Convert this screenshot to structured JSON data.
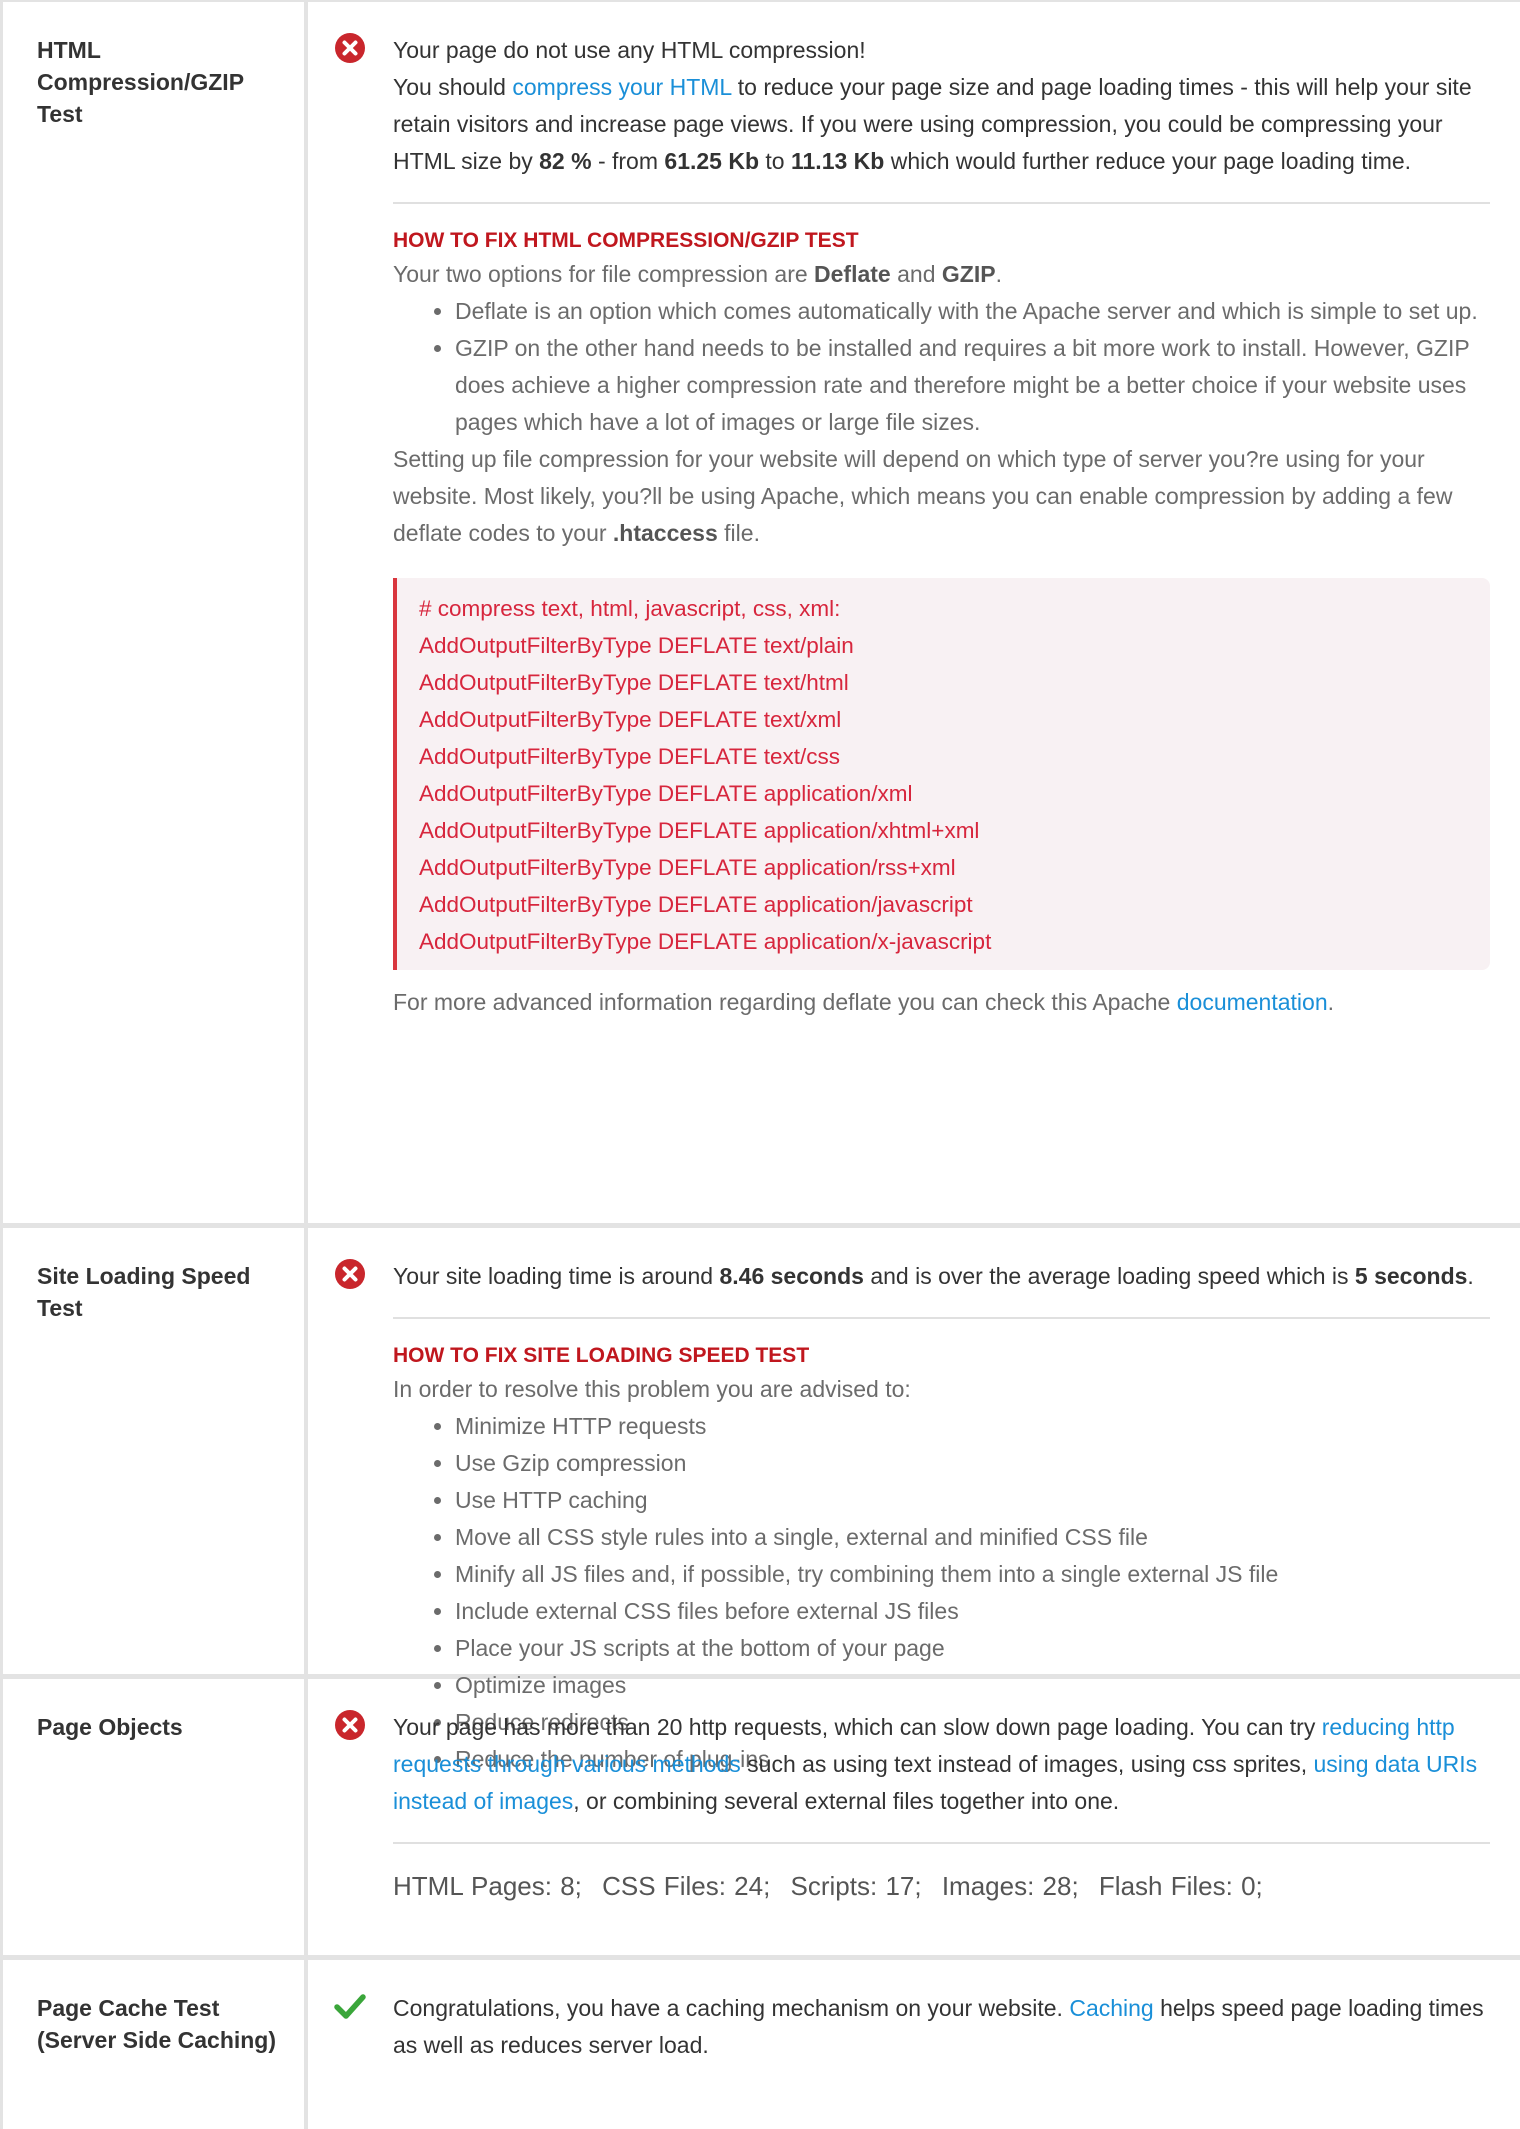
{
  "rows": [
    {
      "name": "HTML Compression/GZIP Test",
      "status": "fail",
      "intro_line1": "Your page do not use any HTML compression!",
      "intro_p_before": "You should ",
      "intro_link": "compress your HTML",
      "intro_p_after1": " to reduce your page size and page loading times - this will help your site retain visitors and increase page views. If you were using compression, you could be compressing your HTML size by ",
      "pct": "82 %",
      "mid1": " - from ",
      "from": "61.25 Kb",
      "mid2": " to ",
      "to": "11.13 Kb",
      "end": " which would further reduce your page loading time.",
      "fix_head": "HOW TO FIX HTML COMPRESSION/GZIP TEST",
      "fix_p1_a": "Your two options for file compression are ",
      "fix_p1_b1": "Deflate",
      "fix_p1_c": " and ",
      "fix_p1_b2": "GZIP",
      "fix_p1_d": ".",
      "fix_list": [
        "Deflate is an option which comes automatically with the Apache server and which is simple to set up.",
        "GZIP on the other hand needs to be installed and requires a bit more work to install. However, GZIP does achieve a higher compression rate and therefore might be a better choice if your website uses pages which have a lot of images or large file sizes."
      ],
      "fix_p2_a": "Setting up file compression for your website will depend on which type of server you?re using for your website. Most likely, you?ll be using Apache, which means you can enable compression by adding a few deflate codes to your ",
      "fix_p2_b": ".htaccess",
      "fix_p2_c": " file.",
      "code_lines": [
        "# compress text, html, javascript, css, xml:",
        "AddOutputFilterByType DEFLATE text/plain",
        "AddOutputFilterByType DEFLATE text/html",
        "AddOutputFilterByType DEFLATE text/xml",
        "AddOutputFilterByType DEFLATE text/css",
        "AddOutputFilterByType DEFLATE application/xml",
        "AddOutputFilterByType DEFLATE application/xhtml+xml",
        "AddOutputFilterByType DEFLATE application/rss+xml",
        "AddOutputFilterByType DEFLATE application/javascript",
        "AddOutputFilterByType DEFLATE application/x-javascript"
      ],
      "adv_a": "For more advanced information regarding deflate you can check this Apache ",
      "adv_link": "documentation",
      "adv_b": "."
    },
    {
      "name": "Site Loading Speed Test",
      "status": "fail",
      "intro_a": "Your site loading time is around ",
      "intro_b1": "8.46 seconds",
      "intro_c": " and is over the average loading speed which is ",
      "intro_b2": "5 seconds",
      "intro_d": ".",
      "fix_head": "HOW TO FIX SITE LOADING SPEED TEST",
      "fix_p1": "In order to resolve this problem you are advised to:",
      "fix_list": [
        "Minimize HTTP requests",
        "Use Gzip compression",
        "Use HTTP caching",
        "Move all CSS style rules into a single, external and minified CSS file",
        "Minify all JS files and, if possible, try combining them into a single external JS file",
        "Include external CSS files before external JS files",
        "Place your JS scripts at the bottom of your page",
        "Optimize images",
        "Reduce redirects",
        "Reduce the number of plug-ins"
      ]
    },
    {
      "name": "Page Objects",
      "status": "fail",
      "intro_a": "Your page has more than 20 http requests, which can slow down page loading. You can try ",
      "intro_link1": "reducing http requests through various methods",
      "intro_b": " such as using text instead of images, using css sprites, ",
      "intro_link2": "using data URIs instead of images",
      "intro_c": ", or combining several external files together into one.",
      "counts": [
        "HTML Pages: 8;",
        "CSS Files: 24;",
        "Scripts: 17;",
        "Images: 28;",
        "Flash Files: 0;"
      ]
    },
    {
      "name": "Page Cache Test (Server Side Caching)",
      "status": "pass",
      "intro_a": "Congratulations, you have a caching mechanism on your website. ",
      "intro_link": "Caching",
      "intro_b": " helps speed page loading times as well as reduces server load."
    }
  ],
  "colors": {
    "fail": "#c9262c",
    "pass": "#3aa63a",
    "link": "#1a8fd8",
    "heading_red": "#c0171e",
    "code_text": "#d7263d"
  },
  "icons": {
    "fail": "x-circle-icon",
    "pass": "check-icon"
  }
}
